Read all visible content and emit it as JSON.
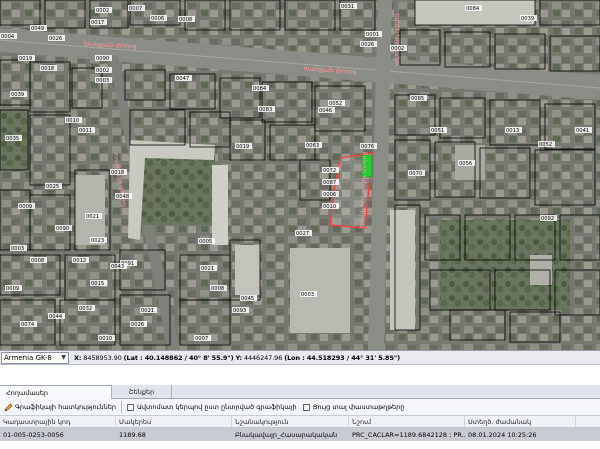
{
  "map": {
    "street_labels": [
      "Խանջյան փողոց",
      "Խանջյան փողոց",
      "Եզնիկ Կողբացու",
      "Եզնիկ Կողբացու փողոց",
      "Բուզանդի փողոց"
    ],
    "parcel_labels": [
      "0008",
      "0006",
      "0007",
      "0002",
      "0017",
      "0031",
      "0084",
      "0039",
      "0001",
      "0026",
      "0002",
      "0004",
      "0049",
      "0026",
      "0019",
      "0018",
      "0090",
      "0002",
      "0003",
      "0047",
      "0039",
      "0085",
      "0083",
      "0084",
      "0046",
      "0052",
      "0010",
      "0011",
      "0076",
      "0051",
      "0013",
      "0041",
      "0052",
      "0063",
      "0070",
      "0056",
      "0018",
      "0035",
      "0092",
      "0019",
      "0072",
      "0087",
      "0006",
      "0010",
      "0009",
      "0048",
      "0025",
      "0021",
      "0023",
      "0027",
      "0005",
      "0003",
      "0008",
      "0012",
      "0091",
      "0015",
      "0043",
      "0032",
      "0021",
      "0026",
      "0074",
      "0010",
      "0007",
      "0093",
      "0003",
      "0090",
      "0009",
      "0008",
      "0045",
      "0044",
      "0021"
    ],
    "highlight_color": "#ff3a3a",
    "marker_color": "#22cc33"
  },
  "statusbar": {
    "crs_value": "Armenia GK-8",
    "x_label": "X:",
    "x_value": "8458953.90",
    "lat_text": "(Lat : 40.148862 / 40° 8' 55.9\")",
    "y_label": "Y:",
    "y_value": "4446247.96",
    "lon_text": "(Lon : 44.518293 / 44° 31' 5.85\")"
  },
  "tabs": [
    {
      "label": "Հողամասեր"
    },
    {
      "label": "Շենքեր"
    }
  ],
  "toolbar": {
    "edit_label": "Գրաֆիկայի հատկություններ",
    "checkbox1_label": "Ավտոմատ կերպով ըստ ընտրված գրաֆիկայի",
    "checkbox2_label": "Ցույց տալ փաստաթղթերը"
  },
  "grid": {
    "columns": [
      "Կադաստրային կոդ",
      "Մակերես",
      "Նշանակություն",
      "Նշում",
      "Ստեղծ. ժամանակ"
    ],
    "rows": [
      [
        "01-005-0253-0056",
        "1189.68",
        "Բնակավայր_Հասարակական",
        "PRC_CACLAR=1189.6842128 ; PR...",
        "08.01.2024 10:25:26"
      ]
    ]
  }
}
